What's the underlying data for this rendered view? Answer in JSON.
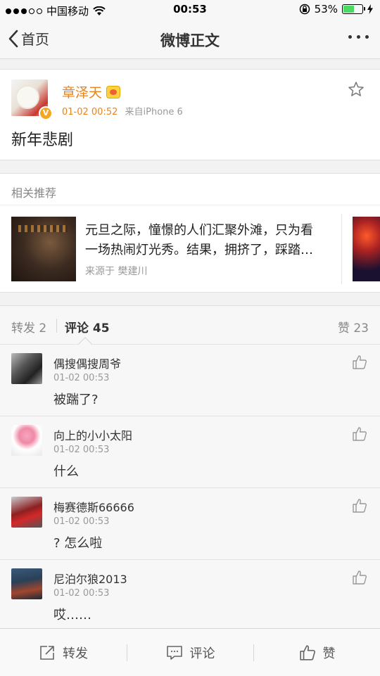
{
  "status_bar": {
    "carrier": "中国移动",
    "time": "00:53",
    "battery": "53%",
    "battery_level": 0.53
  },
  "nav": {
    "back_label": "首页",
    "title": "微博正文"
  },
  "post": {
    "author": "章泽天",
    "time": "01-02 00:52",
    "source": "来自iPhone 6",
    "verified_badge": "V",
    "text": "新年悲剧"
  },
  "related": {
    "header": "相关推荐",
    "line1": "元旦之际，憧憬的人们汇聚外滩，只为看",
    "line2": "一场热闹灯光秀。结果，拥挤了，踩踏…",
    "source": "来源于 樊建川"
  },
  "tabs": {
    "repost": "转发 2",
    "comment": "评论 45",
    "like": "赞 23"
  },
  "comments": [
    {
      "name": "偶搜偶搜周爷",
      "time": "01-02 00:53",
      "text": "被踹了?"
    },
    {
      "name": "向上的小小太阳",
      "time": "01-02 00:53",
      "text": "什么"
    },
    {
      "name": "梅赛德斯66666",
      "time": "01-02 00:53",
      "text": "? 怎么啦"
    },
    {
      "name": "尼泊尔狼2013",
      "time": "01-02 00:53",
      "text": "哎……"
    }
  ],
  "toolbar": {
    "repost": "转发",
    "comment": "评论",
    "like": "赞"
  },
  "colors": {
    "accent_orange": "#e8831d",
    "battery_green": "#4cd964"
  }
}
